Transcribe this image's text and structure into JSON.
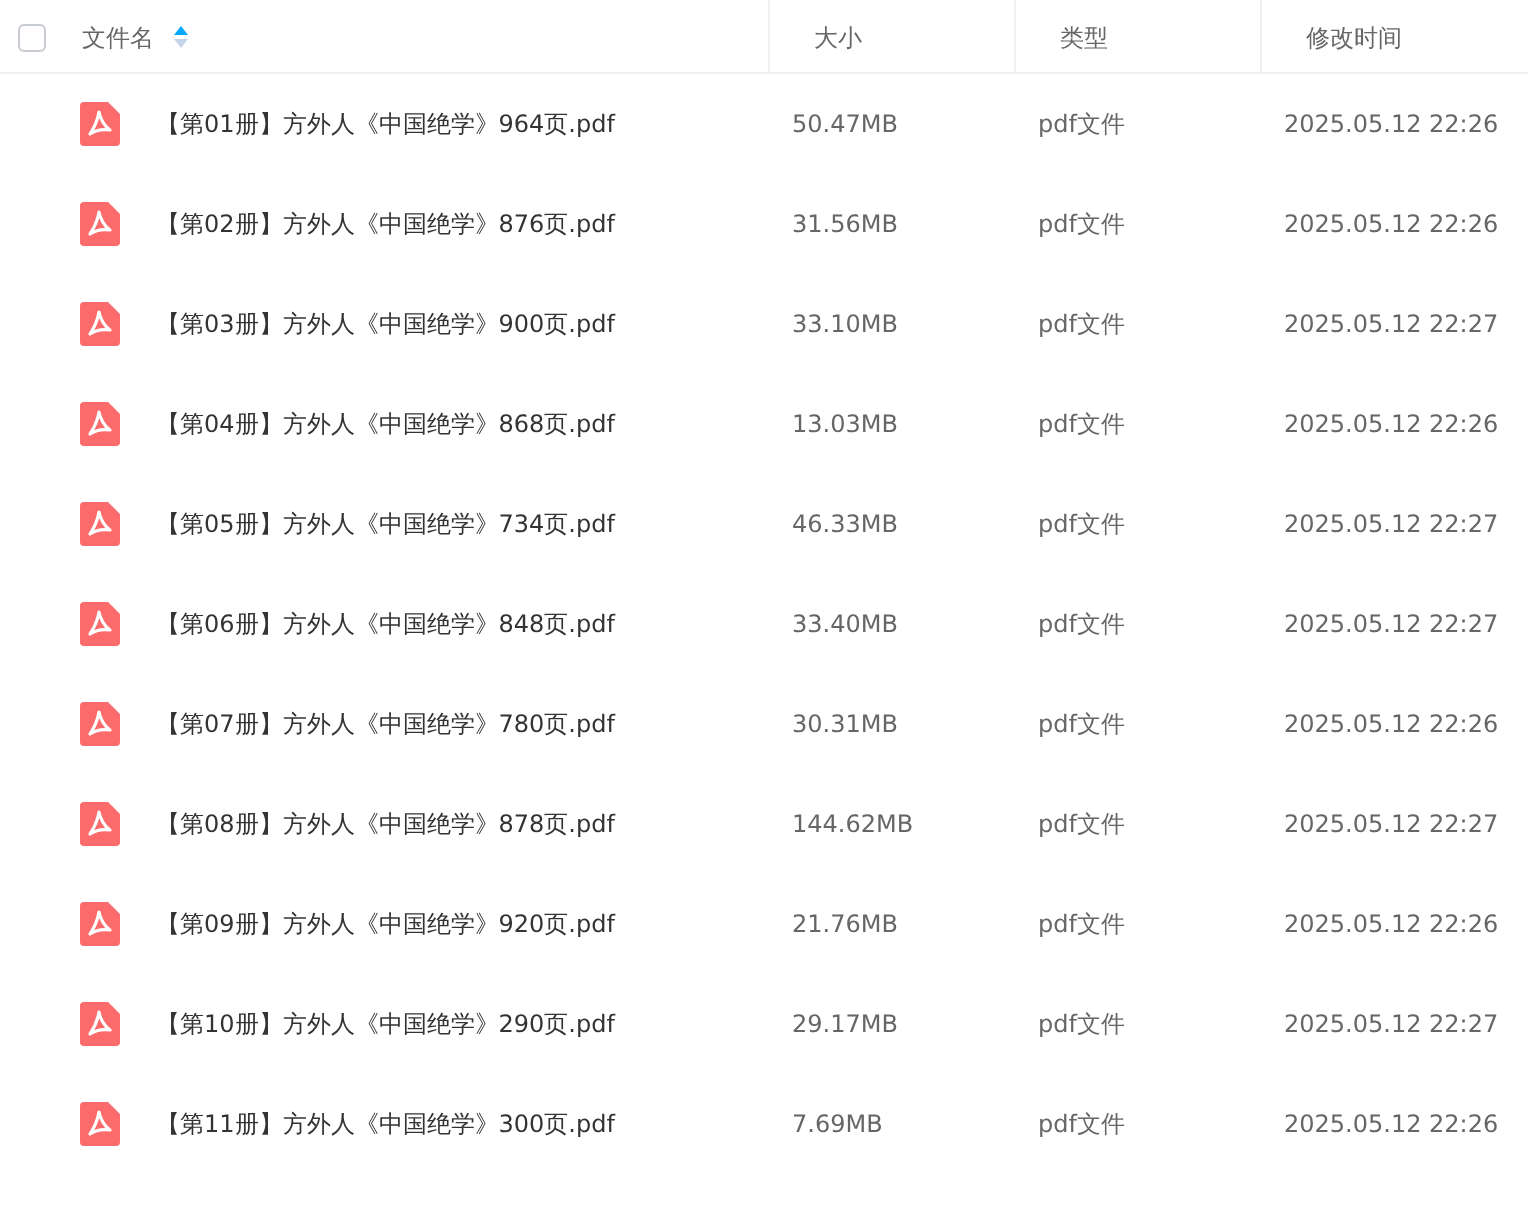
{
  "header": {
    "select_all": {
      "checked": false
    },
    "columns": [
      {
        "label": "文件名",
        "sorted": true
      },
      {
        "label": "大小",
        "sorted": false
      },
      {
        "label": "类型",
        "sorted": false
      },
      {
        "label": "修改时间",
        "sorted": false
      }
    ]
  },
  "rows": [
    {
      "name": "【第01册】方外人《中国绝学》964页.pdf",
      "size": "50.47MB",
      "type": "pdf文件",
      "modified": "2025.05.12 22:26"
    },
    {
      "name": "【第02册】方外人《中国绝学》876页.pdf",
      "size": "31.56MB",
      "type": "pdf文件",
      "modified": "2025.05.12 22:26"
    },
    {
      "name": "【第03册】方外人《中国绝学》900页.pdf",
      "size": "33.10MB",
      "type": "pdf文件",
      "modified": "2025.05.12 22:27"
    },
    {
      "name": "【第04册】方外人《中国绝学》868页.pdf",
      "size": "13.03MB",
      "type": "pdf文件",
      "modified": "2025.05.12 22:26"
    },
    {
      "name": "【第05册】方外人《中国绝学》734页.pdf",
      "size": "46.33MB",
      "type": "pdf文件",
      "modified": "2025.05.12 22:27"
    },
    {
      "name": "【第06册】方外人《中国绝学》848页.pdf",
      "size": "33.40MB",
      "type": "pdf文件",
      "modified": "2025.05.12 22:27"
    },
    {
      "name": "【第07册】方外人《中国绝学》780页.pdf",
      "size": "30.31MB",
      "type": "pdf文件",
      "modified": "2025.05.12 22:26"
    },
    {
      "name": "【第08册】方外人《中国绝学》878页.pdf",
      "size": "144.62MB",
      "type": "pdf文件",
      "modified": "2025.05.12 22:27"
    },
    {
      "name": "【第09册】方外人《中国绝学》920页.pdf",
      "size": "21.76MB",
      "type": "pdf文件",
      "modified": "2025.05.12 22:26"
    },
    {
      "name": "【第10册】方外人《中国绝学》290页.pdf",
      "size": "29.17MB",
      "type": "pdf文件",
      "modified": "2025.05.12 22:27"
    },
    {
      "name": "【第11册】方外人《中国绝学》300页.pdf",
      "size": "7.69MB",
      "type": "pdf文件",
      "modified": "2025.05.12 22:26"
    }
  ]
}
